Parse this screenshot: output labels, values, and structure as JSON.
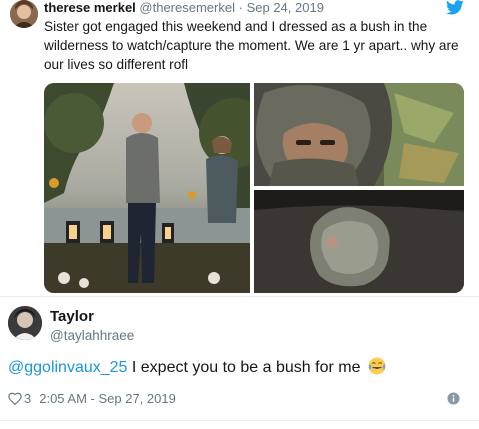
{
  "tweet1": {
    "name": "therese merkel",
    "handle": "@theresemerkel",
    "separator": "·",
    "date": "Sep 24, 2019",
    "text": "Sister got engaged this weekend and I dressed as a bush in the wilderness to watch/capture the moment. We are 1 yr apart.. why are our lives so different rofl",
    "media": [
      {
        "description_icon": "photo-engagement-proposal"
      },
      {
        "description_icon": "photo-bush-selfie"
      },
      {
        "description_icon": "photo-bush-on-ground"
      }
    ]
  },
  "reply": {
    "name": "Taylor",
    "handle": "@taylahhraee",
    "mention": "@ggolinvaux_25",
    "text": " I expect you to be a bush for me",
    "emoji": "face-with-tears-of-joy-icon",
    "like_count": "3",
    "timestamp": "2:05 AM - Sep 27, 2019"
  },
  "colors": {
    "link": "#1b95e0",
    "secondary_text": "#657786",
    "twitter_blue": "#1da1f2"
  }
}
